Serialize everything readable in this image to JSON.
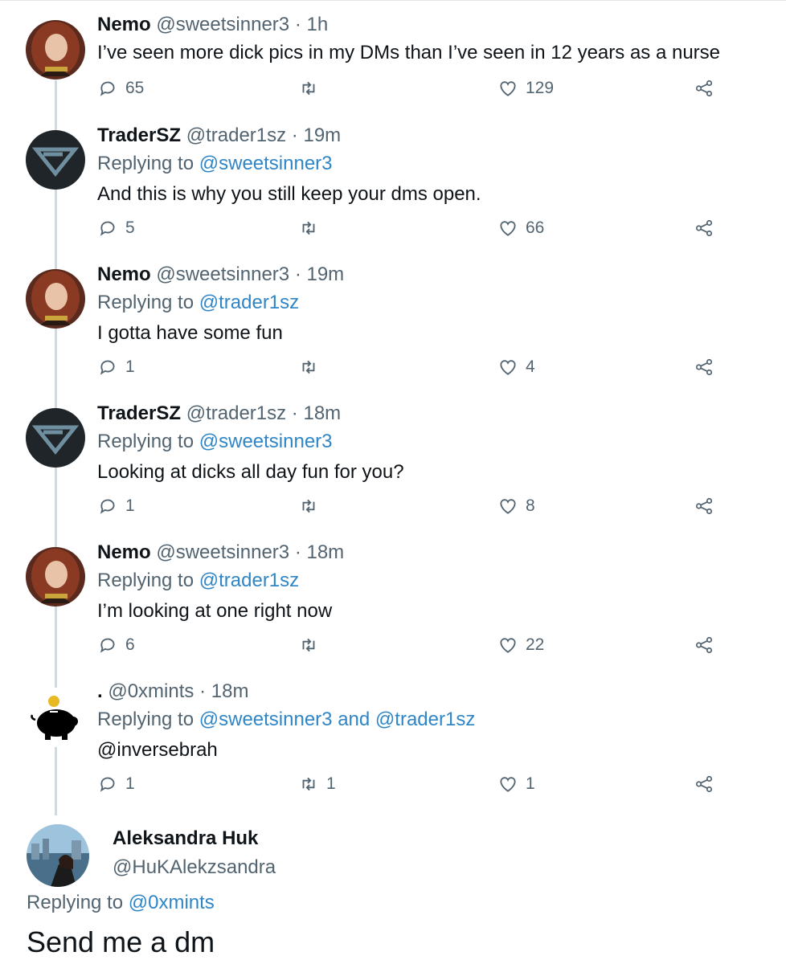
{
  "tweets": [
    {
      "author": "Nemo",
      "handle": "@sweetsinner3",
      "sep": "·",
      "time": "1h",
      "replying_prefix": "",
      "replying_to": "",
      "text": "I’ve seen more dick pics in my DMs than I’ve seen in 12 years as a nurse",
      "replies": "65",
      "retweets": "",
      "likes": "129"
    },
    {
      "author": "TraderSZ",
      "handle": "@trader1sz",
      "sep": "·",
      "time": "19m",
      "replying_prefix": "Replying to",
      "replying_to": "@sweetsinner3",
      "text": "And this is why you still keep your dms open.",
      "replies": "5",
      "retweets": "",
      "likes": "66"
    },
    {
      "author": "Nemo",
      "handle": "@sweetsinner3",
      "sep": "·",
      "time": "19m",
      "replying_prefix": "Replying to",
      "replying_to": "@trader1sz",
      "text": "I gotta have some fun",
      "replies": "1",
      "retweets": "",
      "likes": "4"
    },
    {
      "author": "TraderSZ",
      "handle": "@trader1sz",
      "sep": "·",
      "time": "18m",
      "replying_prefix": "Replying to",
      "replying_to": "@sweetsinner3",
      "text": "Looking at dicks all day fun for you?",
      "replies": "1",
      "retweets": "",
      "likes": "8"
    },
    {
      "author": "Nemo",
      "handle": "@sweetsinner3",
      "sep": "·",
      "time": "18m",
      "replying_prefix": "Replying to",
      "replying_to": "@trader1sz",
      "text": "I’m looking at one right now",
      "replies": "6",
      "retweets": "",
      "likes": "22"
    },
    {
      "author": ".",
      "handle": "@0xmints",
      "sep": "·",
      "time": "18m",
      "replying_prefix": "Replying to",
      "replying_to": "@sweetsinner3",
      "replying_and": "and",
      "replying_to_2": "@trader1sz",
      "text_mention": "@inversebrah",
      "replies": "1",
      "retweets": "1",
      "likes": "1"
    }
  ],
  "final": {
    "author": "Aleksandra Huk",
    "handle": "@HuKAlekzsandra",
    "replying_prefix": "Replying to",
    "replying_to": "@0xmints",
    "text": "Send me a dm"
  },
  "icons": {
    "reply": "reply-icon",
    "retweet": "retweet-icon",
    "like": "heart-icon",
    "share": "share-icon"
  },
  "colors": {
    "mention": "#2f86c7",
    "muted": "#536471",
    "text": "#0f1419",
    "thread_line": "#cfd9de"
  }
}
